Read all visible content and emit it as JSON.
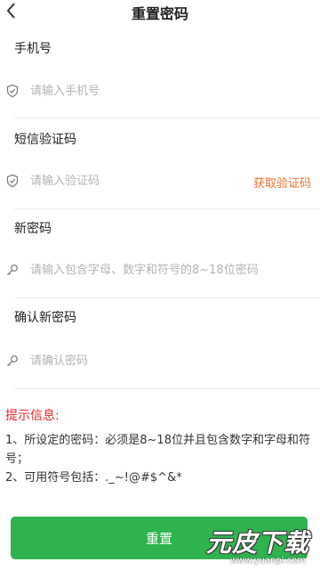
{
  "header": {
    "title": "重置密码"
  },
  "phone": {
    "label": "手机号",
    "placeholder": "请输入手机号"
  },
  "sms": {
    "label": "短信验证码",
    "placeholder": "请输入验证码",
    "get_code": "获取验证码"
  },
  "new_password": {
    "label": "新密码",
    "placeholder": "请输入包含字母、数字和符号的8~18位密码"
  },
  "confirm_password": {
    "label": "确认新密码",
    "placeholder": "请确认密码"
  },
  "tips": {
    "title": "提示信息:",
    "lines": [
      "1、所设定的密码：必须是8~18位并且包含数字和字母和符号；",
      "2、可用符号包括：._~!@#$^&*"
    ]
  },
  "reset_button": "重置",
  "watermark": {
    "main": "元皮下载",
    "url": "www.yuanpi.com"
  },
  "colors": {
    "accent": "#2fb34f",
    "link": "#f0702a",
    "warning": "#e02828"
  }
}
